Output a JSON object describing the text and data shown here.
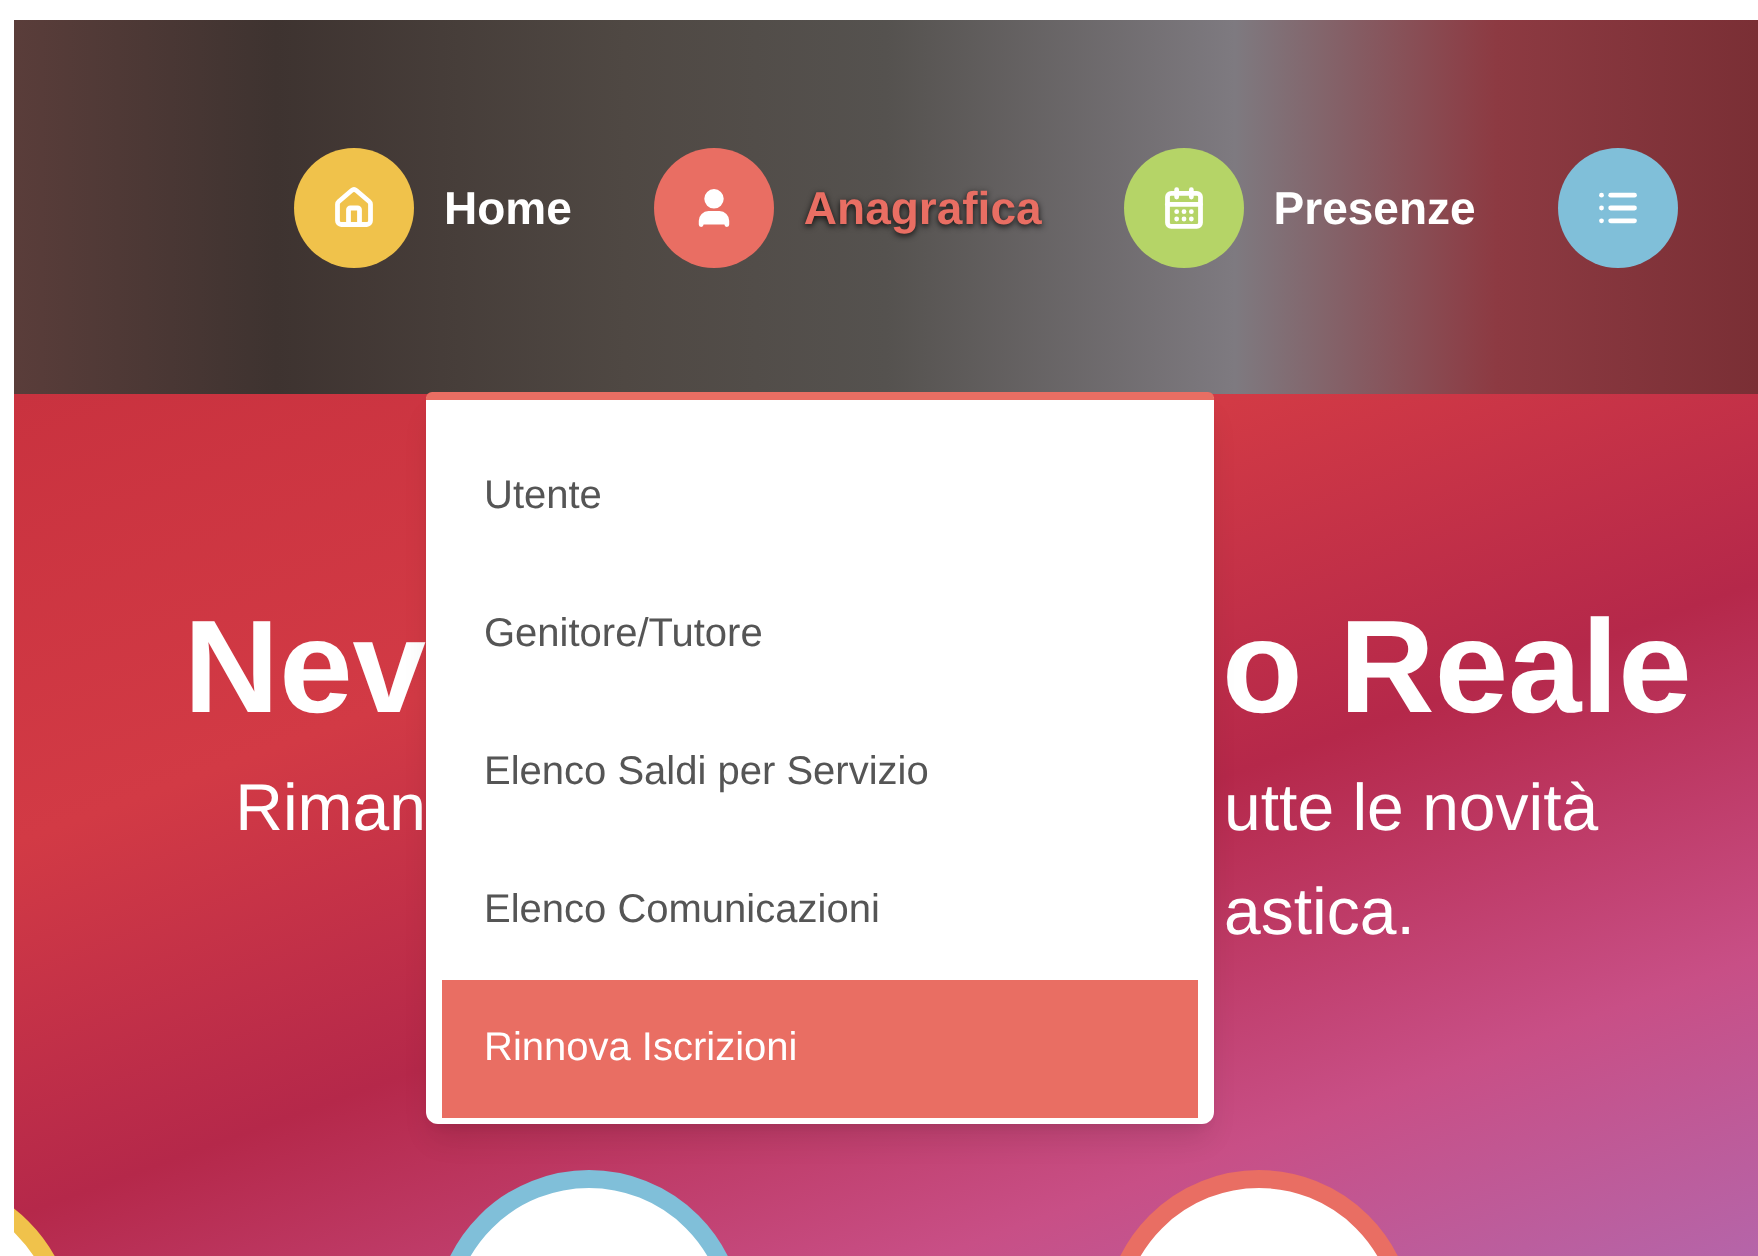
{
  "nav": [
    {
      "label": "Home",
      "color": "#f0c24b",
      "selected": false
    },
    {
      "label": "Anagrafica",
      "color": "#e96e63",
      "selected": true
    },
    {
      "label": "Presenze",
      "color": "#b5d467",
      "selected": false
    },
    {
      "color": "#80bfd9",
      "selected": false
    }
  ],
  "dropdown": [
    {
      "label": "Utente",
      "selected": false
    },
    {
      "label": "Genitore/Tutore",
      "selected": false
    },
    {
      "label": "Elenco Saldi per Servizio",
      "selected": false
    },
    {
      "label": "Elenco Comunicazioni",
      "selected": false
    },
    {
      "label": "Rinnova Iscrizioni",
      "selected": true
    }
  ],
  "hero": {
    "title_left": "Nev",
    "title_right": "o Reale",
    "subtitle_left": "Riman",
    "subtitle_right_1": "utte le novità",
    "subtitle_right_2": "astica."
  },
  "bottom_circles": [
    {
      "color": "#f0c24b"
    },
    {
      "color": "#80bfd9"
    },
    {
      "color": "#e96e63"
    }
  ]
}
